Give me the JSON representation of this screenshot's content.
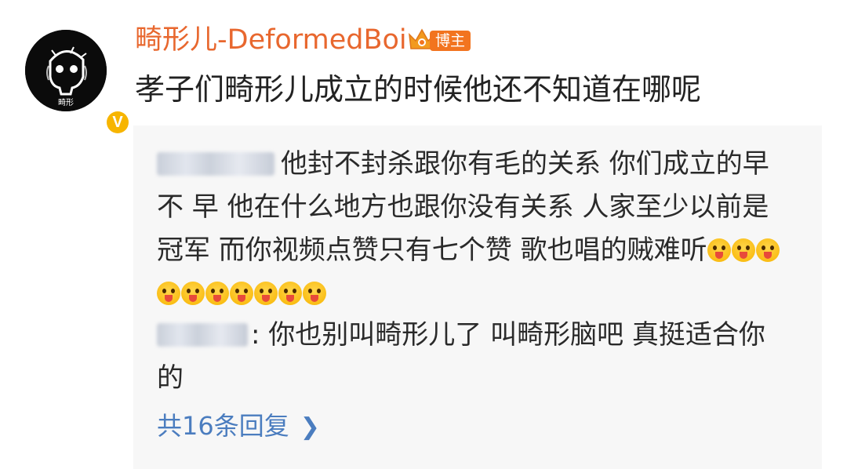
{
  "post": {
    "username": "畸形儿-DeformedBoi",
    "badge_label": "博主",
    "verified_mark": "V",
    "text": "孝子们畸形儿成立的时候他还不知道在哪呢"
  },
  "replies": [
    {
      "text_before_emoji": "他封不封杀跟你有毛的关系 你们成立的早不 早 他在什么地方也跟你没有关系 人家至少以前是冠军 而你视频点赞只有七个赞 歌也唱的贼难听",
      "emoji_count": 10
    },
    {
      "text": ": 你也别叫畸形儿了 叫畸形脑吧 真挺适合你的"
    }
  ],
  "more_replies_label": "共16条回复",
  "colors": {
    "username": "#e8672e",
    "badge": "#f2741f",
    "link": "#4b7dbf",
    "reply_bg": "#f7f7f7"
  },
  "icons": [
    "avatar-skull-icon",
    "verified-v-icon",
    "crown-icon",
    "grin-emoji-icon",
    "chevron-right-icon"
  ]
}
